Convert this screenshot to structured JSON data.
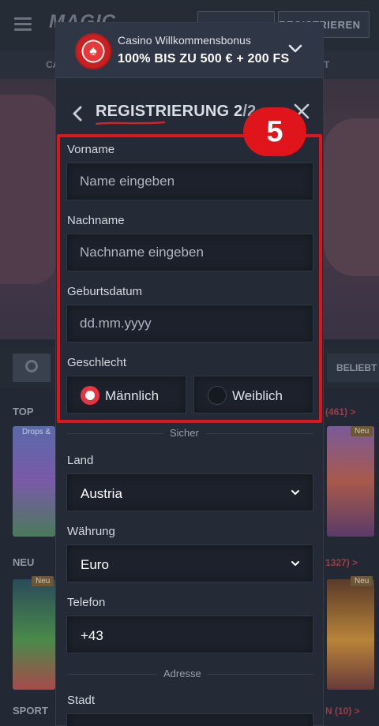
{
  "background": {
    "logo": "MAGIC",
    "register_button": "REGISTRIEREN",
    "subnav_left": "CA",
    "subnav_right": "T",
    "filter_popular": "BELIEBT",
    "sections": [
      {
        "title": "TOP",
        "count": "(461) >"
      },
      {
        "title": "NEU",
        "count": "1327) >"
      },
      {
        "title": "SPORT",
        "count": "N (10) >"
      }
    ],
    "tags": {
      "drops": "Drops &",
      "new": "Neu"
    }
  },
  "bonus_banner": {
    "subtitle": "Casino Willkommensbonus",
    "headline": "100% BIS ZU 500 € + 200 FS",
    "chip_symbol": "♠"
  },
  "header": {
    "title": "REGISTRIERUNG 2",
    "step_suffix": "/2"
  },
  "form": {
    "first_name": {
      "label": "Vorname",
      "placeholder": "Name eingeben",
      "value": ""
    },
    "last_name": {
      "label": "Nachname",
      "placeholder": "Nachname eingeben",
      "value": ""
    },
    "birth_date": {
      "label": "Geburtsdatum",
      "placeholder": "dd.mm.yyyy",
      "value": ""
    },
    "gender": {
      "label": "Geschlecht",
      "options": [
        {
          "label": "Männlich",
          "selected": true
        },
        {
          "label": "Weiblich",
          "selected": false
        }
      ]
    },
    "divider_secure": "Sicher",
    "country": {
      "label": "Land",
      "value": "Austria"
    },
    "currency": {
      "label": "Währung",
      "value": "Euro"
    },
    "phone": {
      "label": "Telefon",
      "value": "+43"
    },
    "divider_address": "Adresse",
    "city": {
      "label": "Stadt"
    }
  },
  "annotation": {
    "step_number": "5"
  },
  "colors": {
    "accent": "#e8343f",
    "highlight": "#e0141b",
    "panel": "#242a36",
    "field": "#1c212b"
  }
}
